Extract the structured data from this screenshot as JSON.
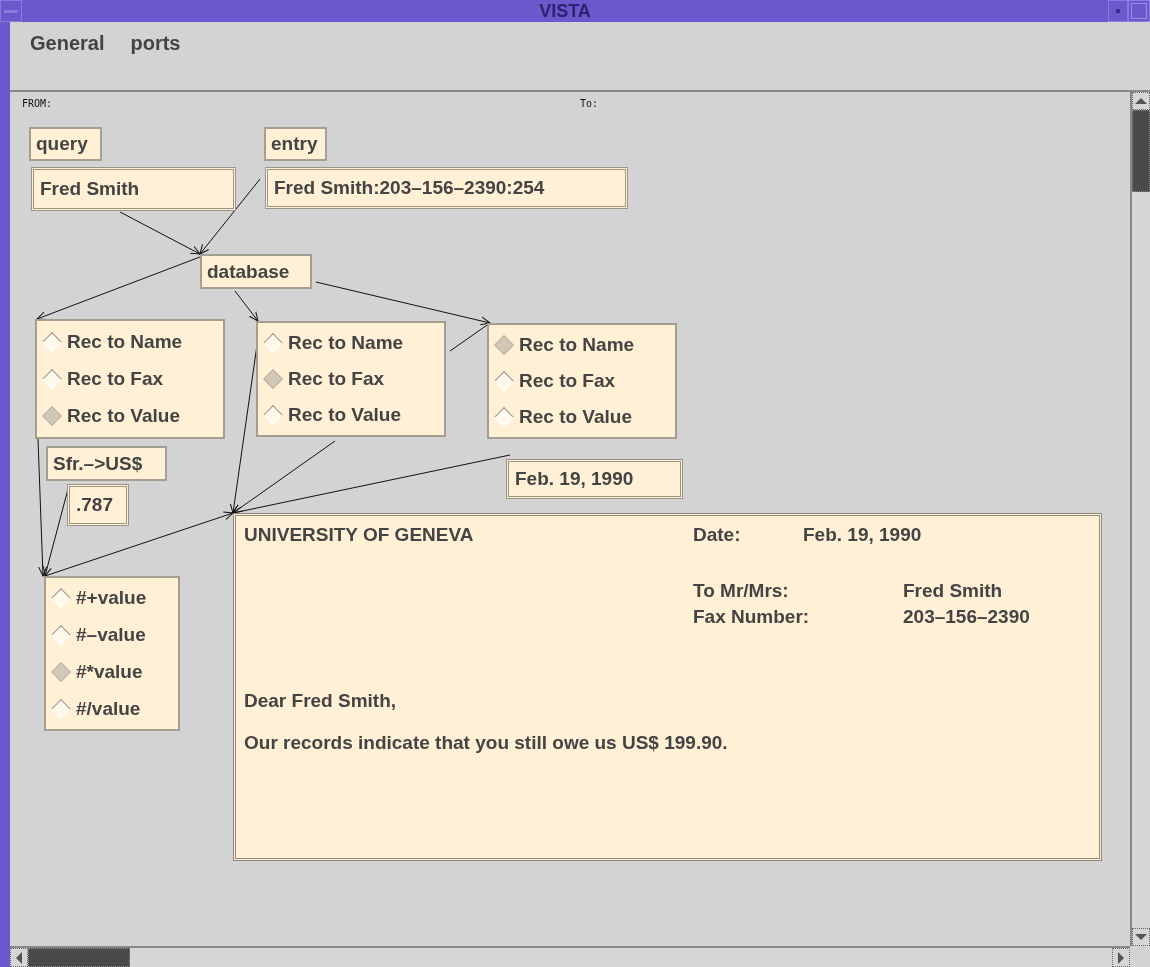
{
  "window": {
    "title": "VISTA"
  },
  "menu": [
    {
      "label": "General"
    },
    {
      "label": "ports"
    }
  ],
  "canvas": {
    "from_label": "FROM:",
    "to_label": "To:",
    "nodes": [
      {
        "kind": "label",
        "text": "query"
      },
      {
        "kind": "label",
        "text": "entry"
      },
      {
        "kind": "field",
        "value": "Fred Smith"
      },
      {
        "kind": "field",
        "value": "Fred Smith:203–156–2390:254"
      },
      {
        "kind": "label",
        "text": "database"
      },
      {
        "kind": "radio_group",
        "options": [
          {
            "label": "Rec to Name",
            "selected": false
          },
          {
            "label": "Rec to Fax",
            "selected": false
          },
          {
            "label": "Rec to Value",
            "selected": true
          }
        ]
      },
      {
        "kind": "radio_group",
        "options": [
          {
            "label": "Rec to Name",
            "selected": false
          },
          {
            "label": "Rec to Fax",
            "selected": true
          },
          {
            "label": "Rec to Value",
            "selected": false
          }
        ]
      },
      {
        "kind": "radio_group",
        "options": [
          {
            "label": "Rec to Name",
            "selected": true
          },
          {
            "label": "Rec to Fax",
            "selected": false
          },
          {
            "label": "Rec to Value",
            "selected": false
          }
        ]
      },
      {
        "kind": "label",
        "text": "Sfr.–>US$"
      },
      {
        "kind": "field",
        "value": ".787"
      },
      {
        "kind": "field",
        "value": "Feb. 19, 1990"
      },
      {
        "kind": "letter",
        "heading": "UNIVERSITY OF GENEVA",
        "date_label": "Date:",
        "date": "Feb. 19, 1990",
        "to_label": "To Mr/Mrs:",
        "to": "Fred Smith",
        "fax_label": "Fax Number:",
        "fax": "203–156–2390",
        "greeting": "Dear Fred Smith,",
        "body": "Our records indicate that you still owe us US$ 199.90."
      },
      {
        "kind": "radio_group",
        "options": [
          {
            "label": "#+value",
            "selected": false
          },
          {
            "label": "#–value",
            "selected": false
          },
          {
            "label": "#*value",
            "selected": true
          },
          {
            "label": "#/value",
            "selected": false
          }
        ]
      }
    ]
  }
}
